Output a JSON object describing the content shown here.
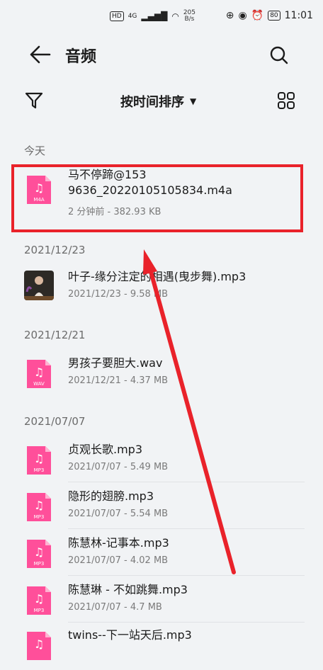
{
  "status_bar": {
    "net_label": "4G",
    "speed_value": "205",
    "speed_unit": "B/s",
    "battery": "80",
    "time": "11:01"
  },
  "header": {
    "title": "音频"
  },
  "toolbar": {
    "sort_label": "按时间排序"
  },
  "sections": [
    {
      "label": "今天",
      "items": [
        {
          "name": "马不停蹄@153*****9636_20220105105834.m4a",
          "name_line1": "马不停蹄@153",
          "name_line2": "9636_20220105105834.m4a",
          "meta": "2 分钟前 - 382.93 KB",
          "type": "M4A"
        }
      ]
    },
    {
      "label": "2021/12/23",
      "items": [
        {
          "name": "叶子-缘分注定的相遇(曳步舞).mp3",
          "meta": "2021/12/23 - 9.58 MB",
          "type": "thumb"
        }
      ]
    },
    {
      "label": "2021/12/21",
      "items": [
        {
          "name": "男孩子要胆大.wav",
          "meta": "2021/12/21 - 4.37 MB",
          "type": "WAV"
        }
      ]
    },
    {
      "label": "2021/07/07",
      "items": [
        {
          "name": "贞观长歌.mp3",
          "meta": "2021/07/07 - 5.49 MB",
          "type": "MP3"
        },
        {
          "name": "隐形的翅膀.mp3",
          "meta": "2021/07/07 - 5.54 MB",
          "type": "MP3"
        },
        {
          "name": "陈慧林-记事本.mp3",
          "meta": "2021/07/07 - 4.02 MB",
          "type": "MP3"
        },
        {
          "name": "陈慧琳 - 不如跳舞.mp3",
          "meta": "2021/07/07 - 4.7 MB",
          "type": "MP3"
        },
        {
          "name": "twins--下一站天后.mp3",
          "meta": "",
          "type": "MP3"
        }
      ]
    }
  ],
  "colors": {
    "file_icon": "#ff4f9a",
    "annotation": "#e9222a",
    "background": "#f1f3f5"
  }
}
